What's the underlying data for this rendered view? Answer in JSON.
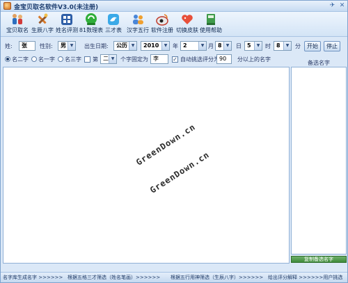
{
  "app": {
    "title": "金宝贝取名软件V3.0(未注册)"
  },
  "toolbar": {
    "items": [
      {
        "label": "宝贝取名",
        "icon": "family-icon"
      },
      {
        "label": "生辰八字",
        "icon": "tools-icon"
      },
      {
        "label": "姓名评测",
        "icon": "grid-icon"
      },
      {
        "label": "81数理表",
        "icon": "chat-icon"
      },
      {
        "label": "三才表",
        "icon": "bird-icon"
      },
      {
        "label": "汉字五行",
        "icon": "users-icon"
      },
      {
        "label": "软件注册",
        "icon": "weibo-icon"
      },
      {
        "label": "切换皮肤",
        "icon": "heart-icon"
      },
      {
        "label": "使用帮助",
        "icon": "book-icon"
      }
    ]
  },
  "form": {
    "surname_label": "姓:",
    "surname_value": "张",
    "gender_label": "性别:",
    "gender_value": "男",
    "birth_label": "出生日期:",
    "calendar_value": "公历",
    "year_value": "2010",
    "year_unit": "年",
    "month_value": "2",
    "month_unit": "月",
    "day_value": "8",
    "day_unit": "日",
    "hour_value": "5",
    "hour_unit": "时",
    "minute_value": "8",
    "minute_unit": "分",
    "start_button": "开始",
    "stop_button": "停止"
  },
  "options": {
    "radio_two": "名二字",
    "radio_one": "名一字",
    "radio_three": "名三字",
    "fixed_checkbox_prefix": "第",
    "fixed_position_value": "二",
    "fixed_text": "个字固定为",
    "fixed_char_value": "李",
    "auto_checkbox_label": "自动挑选评分为",
    "score_value": "90",
    "score_suffix": "分以上的名字"
  },
  "side": {
    "title": "备选名字",
    "copy_button": "复制备选名字"
  },
  "watermarks": [
    "GreenDown.cn",
    "GreenDown.cn"
  ],
  "status": {
    "segments": [
      "名字库生成名字 >>>>>>",
      "根据五格三才筛选（姓名笔画）>>>>>>",
      "根据五行用神筛选（生辰八字）>>>>>>",
      "给出评分解释 >>>>>>用户挑选"
    ]
  }
}
